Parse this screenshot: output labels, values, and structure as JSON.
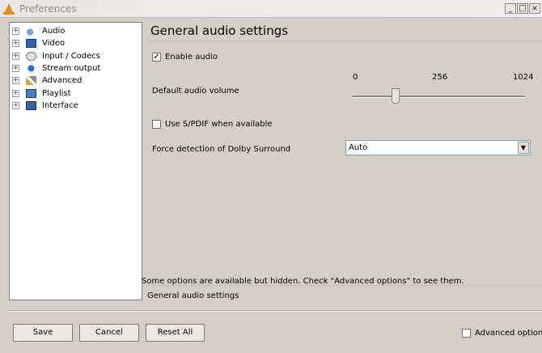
{
  "window": {
    "title": "Preferences",
    "controls": [
      "_",
      "□",
      "×"
    ]
  },
  "tree": {
    "items": [
      {
        "label": "Audio",
        "icon": "speaker-icon",
        "expander": "+"
      },
      {
        "label": "Video",
        "icon": "video-icon",
        "expander": "+"
      },
      {
        "label": "Input / Codecs",
        "icon": "input-codecs-icon",
        "expander": "+"
      },
      {
        "label": "Stream output",
        "icon": "stream-output-icon",
        "expander": "+"
      },
      {
        "label": "Advanced",
        "icon": "advanced-icon",
        "expander": "+"
      },
      {
        "label": "Playlist",
        "icon": "playlist-icon",
        "expander": "+"
      },
      {
        "label": "Interface",
        "icon": "interface-icon",
        "expander": "+"
      }
    ]
  },
  "main": {
    "title": "General audio settings",
    "enable_audio": {
      "label": "Enable audio",
      "checked": true,
      "mark": "✓"
    },
    "volume": {
      "label": "Default audio volume",
      "ticks": [
        "0",
        "256",
        "1024"
      ],
      "value_fraction": 0.25
    },
    "spdif": {
      "label": "Use S/PDIF when available",
      "checked": false
    },
    "dolby": {
      "label": "Force detection of Dolby Surround",
      "value": "Auto",
      "arrow": "▼"
    }
  },
  "hint_text": "Some options are available but hidden. Check \"Advanced options\" to see them.",
  "status_text": "General audio settings",
  "footer": {
    "save": "Save",
    "cancel": "Cancel",
    "reset_all": "Reset All",
    "advanced_options": {
      "label": "Advanced options",
      "checked": false
    }
  }
}
